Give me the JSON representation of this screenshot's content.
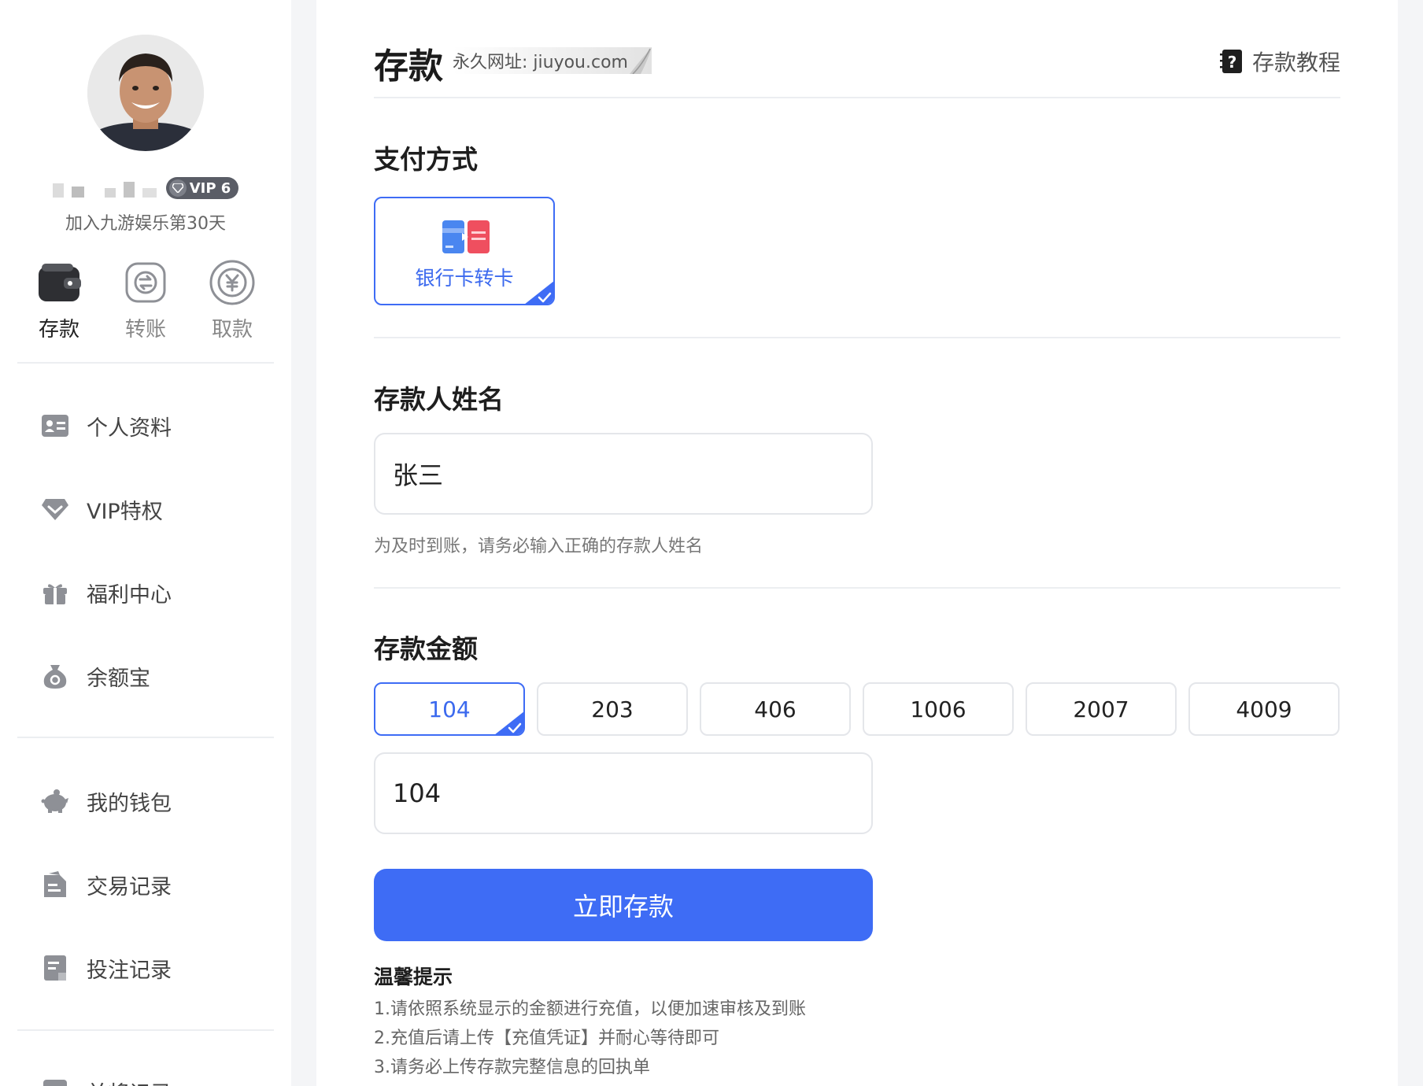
{
  "user": {
    "vip_label": "VIP 6",
    "join_text": "加入九游娱乐第30天"
  },
  "quick_actions": [
    {
      "label": "存款",
      "icon": "wallet-icon",
      "active": true
    },
    {
      "label": "转账",
      "icon": "transfer-icon",
      "active": false
    },
    {
      "label": "取款",
      "icon": "yuan-coin-icon",
      "active": false
    }
  ],
  "menu_group_1": [
    {
      "label": "个人资料",
      "icon": "id-card-icon"
    },
    {
      "label": "VIP特权",
      "icon": "vip-gem-icon"
    },
    {
      "label": "福利中心",
      "icon": "gift-icon"
    },
    {
      "label": "余额宝",
      "icon": "money-bag-icon"
    }
  ],
  "menu_group_2": [
    {
      "label": "我的钱包",
      "icon": "piggy-bank-icon"
    },
    {
      "label": "交易记录",
      "icon": "transaction-record-icon"
    },
    {
      "label": "投注记录",
      "icon": "bet-record-icon"
    }
  ],
  "menu_group_3": [
    {
      "label": "并将记录",
      "icon": "reward-record-icon"
    }
  ],
  "header": {
    "title": "存款",
    "domain_text": "永久网址: jiuyou.com",
    "tutorial_label": "存款教程"
  },
  "payment": {
    "title": "支付方式",
    "method_label": "银行卡转卡"
  },
  "depositor": {
    "title": "存款人姓名",
    "value": "张三",
    "hint": "为及时到账，请务必输入正确的存款人姓名"
  },
  "amount": {
    "title": "存款金额",
    "options": [
      "104",
      "203",
      "406",
      "1006",
      "2007",
      "4009"
    ],
    "selected": "104",
    "value": "104"
  },
  "submit_label": "立即存款",
  "tips": {
    "title": "温馨提示",
    "items": [
      "1.请依照系统显示的金额进行充值，以便加速审核及到账",
      "2.充值后请上传【充值凭证】并耐心等待即可",
      "3.请务必上传存款完整信息的回执单"
    ]
  },
  "colors": {
    "accent": "#3e6cf5",
    "accent_text": "#3b69ee",
    "bank_blue": "#4a86f0",
    "bank_red": "#ef4f5f"
  }
}
